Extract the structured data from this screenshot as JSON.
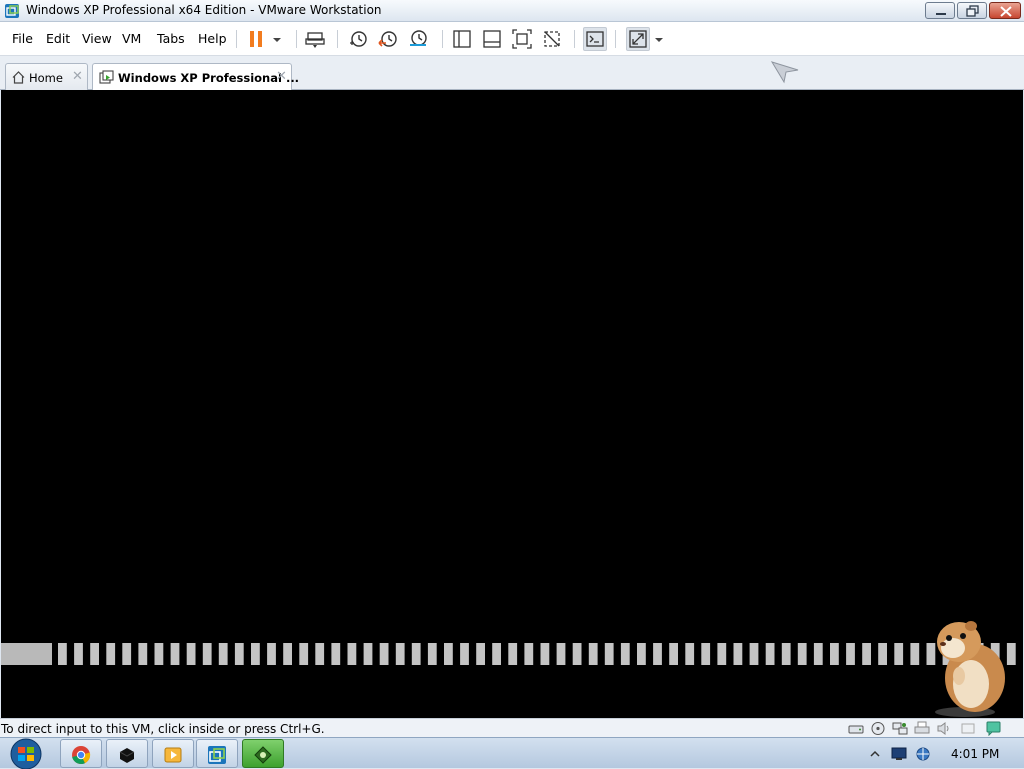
{
  "window": {
    "title": "Windows XP Professional x64 Edition - VMware Workstation",
    "app_icon": "vmware-icon"
  },
  "menu": {
    "items": [
      {
        "label": "File"
      },
      {
        "label": "Edit"
      },
      {
        "label": "View"
      },
      {
        "label": "VM"
      },
      {
        "label": "Tabs"
      },
      {
        "label": "Help"
      }
    ]
  },
  "toolbar": {
    "icons": [
      "pause-icon",
      "dropdown-arrow-icon",
      "send-ctrl-alt-del-icon",
      "snapshot-icon",
      "revert-snapshot-icon",
      "snapshot-manager-icon",
      "show-library-icon",
      "thumbnail-bar-icon",
      "full-screen-icon",
      "unity-icon",
      "console-view-icon",
      "stretch-guest-icon",
      "dropdown-arrow-icon"
    ],
    "accent_color": "#f27c1f"
  },
  "tabs": [
    {
      "label": "Home",
      "icon": "home-icon",
      "active": false
    },
    {
      "label": "Windows XP Professional ...",
      "icon": "vm-tab-icon",
      "active": true
    }
  ],
  "vm": {
    "screen_color": "#000000",
    "progress_segments": 60,
    "mascot": "hamster-mascot"
  },
  "statusbar": {
    "text": "To direct input to this VM, click inside or press Ctrl+G.",
    "icons": [
      "hard-disk-icon",
      "cd-dvd-icon",
      "network-icon",
      "printer-icon",
      "sound-icon",
      "message-icon"
    ]
  },
  "taskbar": {
    "buttons": [
      {
        "name": "chrome-taskbar-button",
        "icon": "chrome-icon",
        "active": false
      },
      {
        "name": "app-taskbar-button",
        "icon": "black-cube-icon",
        "active": false
      },
      {
        "name": "media-player-taskbar-button",
        "icon": "media-player-icon",
        "active": false
      },
      {
        "name": "vmware-taskbar-button",
        "icon": "vmware-icon",
        "active": false
      },
      {
        "name": "green-app-taskbar-button",
        "icon": "green-app-icon",
        "active": true
      }
    ],
    "tray_icons": [
      "show-hidden-icons-arrow",
      "monitor-icon",
      "network-tray-icon"
    ],
    "clock": "4:01 PM"
  }
}
